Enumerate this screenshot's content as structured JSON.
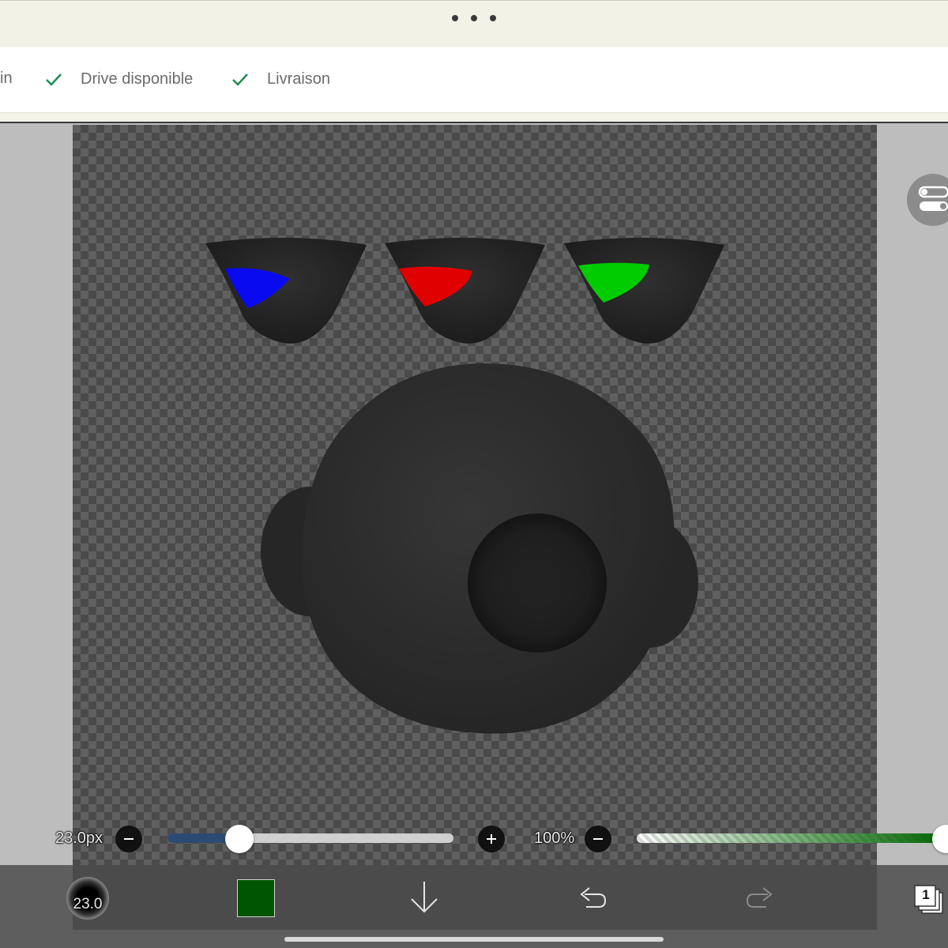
{
  "browser": {
    "menu_icon": "more-dots-icon"
  },
  "webpage": {
    "cut_text": "in",
    "features": [
      {
        "icon": "check-icon",
        "label": "Drive disponible"
      },
      {
        "icon": "check-icon",
        "label": "Livraison"
      }
    ],
    "check_color": "#1e8a4e"
  },
  "canvas": {
    "panel_toggle_icon": "toggle-switches-icon",
    "drawing": {
      "shapes": [
        "eye-cup-blue",
        "eye-cup-red",
        "eye-cup-green",
        "head-sphere"
      ],
      "accent_colors": [
        "#0000ff",
        "#ff0000",
        "#00ff00"
      ]
    }
  },
  "brush": {
    "size_label": "23.0px",
    "size_fraction": 0.25,
    "size_value": "23.0",
    "opacity_label": "100%",
    "opacity_fraction": 1.0,
    "color": "#005500",
    "track_fill_color": "#2c4a74"
  },
  "toolbar": {
    "brush_icon": "brush-preview-icon",
    "color_icon": "color-swatch-icon",
    "download_icon": "arrow-down-icon",
    "undo_icon": "undo-icon",
    "redo_icon": "redo-icon",
    "layers_icon": "layers-icon",
    "layers_count": "1"
  }
}
